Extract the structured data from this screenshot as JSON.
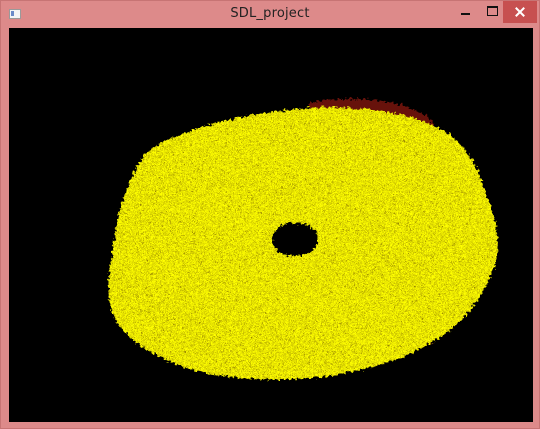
{
  "window": {
    "title": "SDL_project"
  },
  "colors": {
    "frame": "#dd8a8a",
    "close_button": "#c75050",
    "canvas_background": "#000000",
    "blob_fill": "#ffff00",
    "blob_edge_tint": "#9b1b12",
    "hole": "#000000"
  },
  "icons": [
    "app-icon",
    "minimize-icon",
    "maximize-icon",
    "close-icon"
  ]
}
